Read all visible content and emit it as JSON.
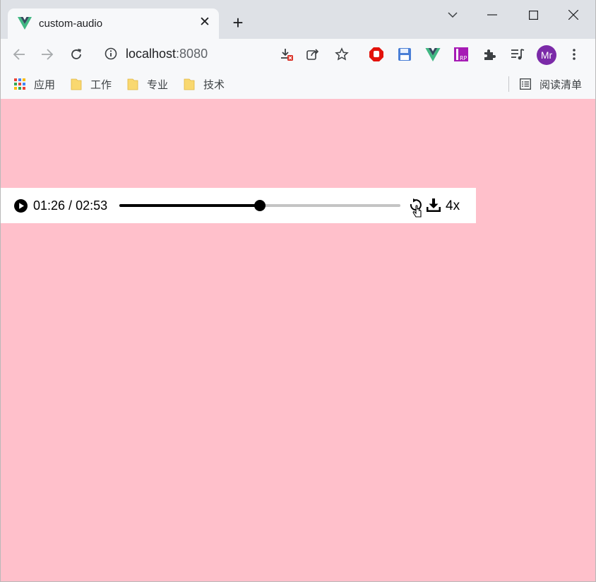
{
  "browser": {
    "tab": {
      "title": "custom-audio",
      "close_glyph": "✕",
      "favicon": "vue-logo-icon"
    },
    "new_tab_glyph": "+",
    "address": {
      "host": "localhost",
      "port": ":8080"
    },
    "profile_initials": "Mr",
    "extensions": [
      "adblock-icon",
      "save-disk-icon",
      "vue-devtools-icon",
      "rp-icon",
      "puzzle-extensions-icon",
      "media-queue-icon"
    ],
    "bookmarks": [
      {
        "label": "应用",
        "icon": "apps-grid-icon"
      },
      {
        "label": "工作",
        "icon": "folder-icon"
      },
      {
        "label": "专业",
        "icon": "folder-icon"
      },
      {
        "label": "技术",
        "icon": "folder-icon"
      }
    ],
    "reading_list": "阅读清单"
  },
  "page": {
    "background": "#ffc0cb",
    "player": {
      "current_time": "01:26",
      "separator": " / ",
      "duration": "02:53",
      "progress": 0.5,
      "speed": "4x"
    }
  }
}
